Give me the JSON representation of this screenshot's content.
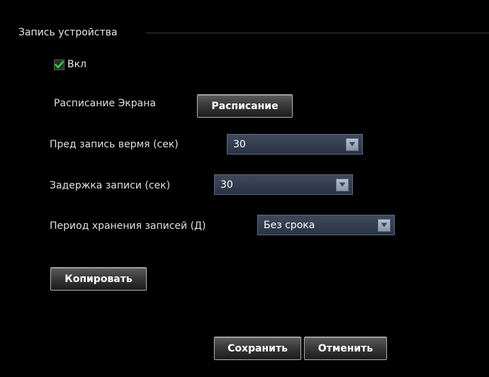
{
  "section": {
    "title": "Запись устройства"
  },
  "enable": {
    "label": "Вкл",
    "checked": true
  },
  "schedule": {
    "label": "Расписание Экрана",
    "button_label": "Расписание"
  },
  "prerecord": {
    "label": "Пред запись вермя (сек)",
    "value": "30"
  },
  "delay": {
    "label": "Задержка записи (сек)",
    "value": "30"
  },
  "retention": {
    "label": "Период хранения записей (Д)",
    "value": "Без срока"
  },
  "actions": {
    "copy_label": "Копировать",
    "save_label": "Сохранить",
    "cancel_label": "Отменить"
  },
  "icons": {
    "checkbox": "checkmark-icon",
    "dropdown": "chevron-down-icon"
  },
  "colors": {
    "background": "#000000",
    "checkmark": "#2fd13c",
    "select_bg": "#2f3a4c"
  }
}
